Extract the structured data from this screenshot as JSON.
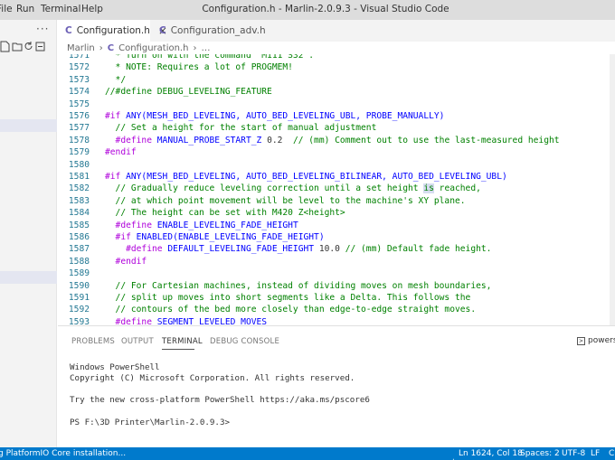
{
  "menu": [
    "File",
    "Run",
    "Terminal",
    "Help"
  ],
  "window_title": "Configuration.h - Marlin-2.0.9.3 - Visual Studio Code",
  "sidebar": {
    "more": "···"
  },
  "tabs": [
    {
      "label": "Configuration.h",
      "badge": "C",
      "close": "×"
    },
    {
      "label": "Configuration_adv.h",
      "badge": "C"
    }
  ],
  "breadcrumb": {
    "root": "Marlin",
    "sep": "›",
    "badge": "C",
    "file": "Configuration.h",
    "more": "…"
  },
  "editor": {
    "lines": [
      {
        "n": "1571",
        "segs": [
          {
            "t": "  * Turn on with the command 'M111 S32'.",
            "c": "cm"
          }
        ]
      },
      {
        "n": "1572",
        "segs": [
          {
            "t": "  * NOTE: Requires a lot of PROGMEM!",
            "c": "cm"
          }
        ]
      },
      {
        "n": "1573",
        "segs": [
          {
            "t": "  */",
            "c": "cm"
          }
        ]
      },
      {
        "n": "1574",
        "segs": [
          {
            "t": "//#define DEBUG_LEVELING_FEATURE",
            "c": "cm"
          }
        ]
      },
      {
        "n": "1575",
        "segs": []
      },
      {
        "n": "1576",
        "segs": [
          {
            "t": "#if ",
            "c": "pp"
          },
          {
            "t": "ANY(MESH_BED_LEVELING, AUTO_BED_LEVELING_UBL, PROBE_MANUALLY)",
            "c": "id"
          }
        ]
      },
      {
        "n": "1577",
        "segs": [
          {
            "t": "  // Set a height for the start of manual adjustment",
            "c": "cm"
          }
        ]
      },
      {
        "n": "1578",
        "segs": [
          {
            "t": "  #define ",
            "c": "pp"
          },
          {
            "t": "MANUAL_PROBE_START_Z",
            "c": "id"
          },
          {
            "t": " 0.2  ",
            "c": ""
          },
          {
            "t": "// (mm) Comment out to use the last-measured height",
            "c": "cm"
          }
        ]
      },
      {
        "n": "1579",
        "segs": [
          {
            "t": "#endif",
            "c": "pp"
          }
        ]
      },
      {
        "n": "1580",
        "segs": []
      },
      {
        "n": "1581",
        "segs": [
          {
            "t": "#if ",
            "c": "pp"
          },
          {
            "t": "ANY(MESH_BED_LEVELING, AUTO_BED_LEVELING_BILINEAR, AUTO_BED_LEVELING_UBL)",
            "c": "id"
          }
        ]
      },
      {
        "n": "1582",
        "segs": [
          {
            "t": "  // Gradually reduce leveling correction until a set height ",
            "c": "cm"
          },
          {
            "t": "is",
            "c": "cm hl"
          },
          {
            "t": " reached,",
            "c": "cm"
          }
        ]
      },
      {
        "n": "1583",
        "segs": [
          {
            "t": "  // at which point movement will be level to the machine's XY plane.",
            "c": "cm"
          }
        ]
      },
      {
        "n": "1584",
        "segs": [
          {
            "t": "  // The height can be set with M420 Z<height>",
            "c": "cm"
          }
        ]
      },
      {
        "n": "1585",
        "segs": [
          {
            "t": "  #define ",
            "c": "pp"
          },
          {
            "t": "ENABLE_LEVELING_FADE_HEIGHT",
            "c": "id"
          }
        ]
      },
      {
        "n": "1586",
        "segs": [
          {
            "t": "  #if ",
            "c": "pp"
          },
          {
            "t": "ENABLED(ENABLE_LEVELING_FADE_HEIGHT)",
            "c": "id"
          }
        ]
      },
      {
        "n": "1587",
        "segs": [
          {
            "t": "    #define ",
            "c": "pp"
          },
          {
            "t": "DEFAULT_LEVELING_FADE_HEIGHT",
            "c": "id"
          },
          {
            "t": " 10.0 ",
            "c": ""
          },
          {
            "t": "// (mm) Default fade height.",
            "c": "cm"
          }
        ]
      },
      {
        "n": "1588",
        "segs": [
          {
            "t": "  #endif",
            "c": "pp"
          }
        ]
      },
      {
        "n": "1589",
        "segs": []
      },
      {
        "n": "1590",
        "segs": [
          {
            "t": "  // For Cartesian machines, instead of dividing moves on mesh boundaries,",
            "c": "cm"
          }
        ]
      },
      {
        "n": "1591",
        "segs": [
          {
            "t": "  // split up moves into short segments like a Delta. This follows the",
            "c": "cm"
          }
        ]
      },
      {
        "n": "1592",
        "segs": [
          {
            "t": "  // contours of the bed more closely than edge-to-edge straight moves.",
            "c": "cm"
          }
        ]
      },
      {
        "n": "1593",
        "segs": [
          {
            "t": "  #define ",
            "c": "pp"
          },
          {
            "t": "SEGMENT_LEVELED_MOVES",
            "c": "id"
          }
        ]
      }
    ]
  },
  "panel": {
    "tabs": [
      "PROBLEMS",
      "OUTPUT",
      "TERMINAL",
      "DEBUG CONSOLE"
    ],
    "shell": "powersh",
    "terminal_lines": [
      "Windows PowerShell",
      "Copyright (C) Microsoft Corporation. All rights reserved.",
      "",
      "Try the new cross-platform PowerShell https://aka.ms/pscore6",
      "",
      "PS F:\\3D Printer\\Marlin-2.0.9.3>"
    ]
  },
  "status": {
    "left": "g PlatformIO Core installation...",
    "position": "Ln 1624, Col 18",
    "spaces": "Spaces: 2",
    "encoding": "UTF-8",
    "eol": "LF",
    "lang": "C"
  },
  "colors": {
    "statusbar": "#007acc",
    "comment": "#008000",
    "preprocessor": "#af00db",
    "identifier": "#0000ff",
    "line_number": "#237893",
    "c_badge": "#6b5fb5"
  }
}
